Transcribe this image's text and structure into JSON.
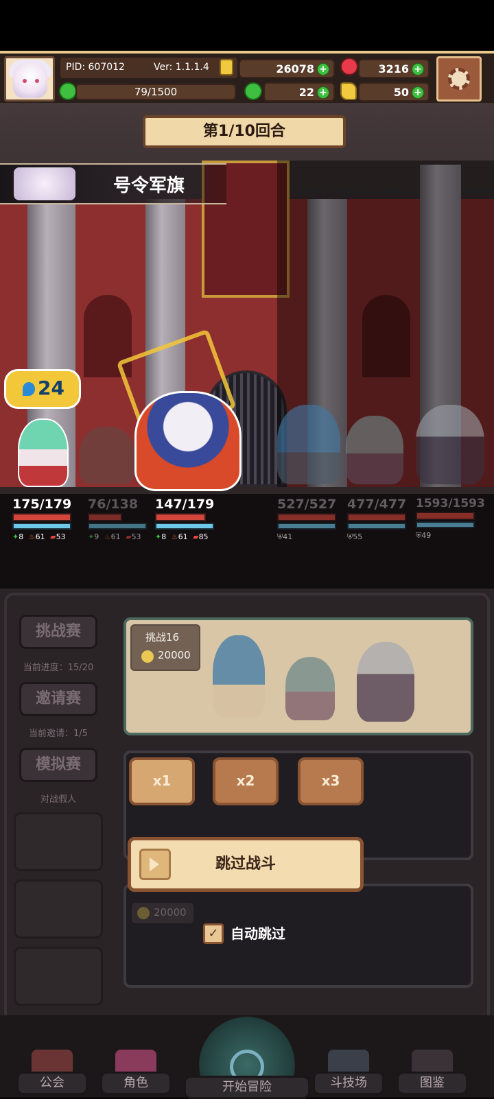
{
  "header": {
    "pid": "PID: 607012",
    "version": "Ver: 1.1.1.4",
    "exp": "79/1500",
    "gold": "26078",
    "gems": "3216",
    "clover": "22",
    "other_currency": "50",
    "plus": "+"
  },
  "battle": {
    "round": "第1/10回合",
    "skill_name": "号令军旗",
    "buff_value": "24",
    "allies": [
      {
        "hp": "175/179",
        "atk": "8",
        "fire": "61",
        "spd": "53"
      },
      {
        "hp": "76/138",
        "atk": "9",
        "fire": "61",
        "spd": "53"
      },
      {
        "hp": "147/179",
        "atk": "8",
        "fire": "61",
        "spd": "85"
      }
    ],
    "enemies": [
      {
        "hp": "527/527",
        "shield": "41"
      },
      {
        "hp": "477/477",
        "shield": "55"
      },
      {
        "hp": "1593/1593",
        "shield": "49"
      }
    ]
  },
  "sidebar": {
    "challenge_label": "挑战赛",
    "challenge_progress": "当前进度：15/20",
    "invite_label": "邀请赛",
    "invite_progress": "当前邀请：1/5",
    "sim_label": "模拟赛",
    "sim_note": "对战假人"
  },
  "cards": {
    "challenge_title": "挑战16",
    "challenge_reward": "20000",
    "third_reward": "20000"
  },
  "speed": {
    "x1": "x1",
    "x2": "x2",
    "x3": "x3"
  },
  "skip": {
    "label": "跳过战斗",
    "auto_label": "自动跳过",
    "auto_checked": "✓"
  },
  "nav": {
    "guild": "公会",
    "character": "角色",
    "start": "开始冒险",
    "arena": "斗技场",
    "codex": "图鉴"
  },
  "colors": {
    "accent": "#e9c98d",
    "hp": "#d4453b",
    "mp": "#6ec8e8",
    "plus": "#3fbf3f"
  }
}
